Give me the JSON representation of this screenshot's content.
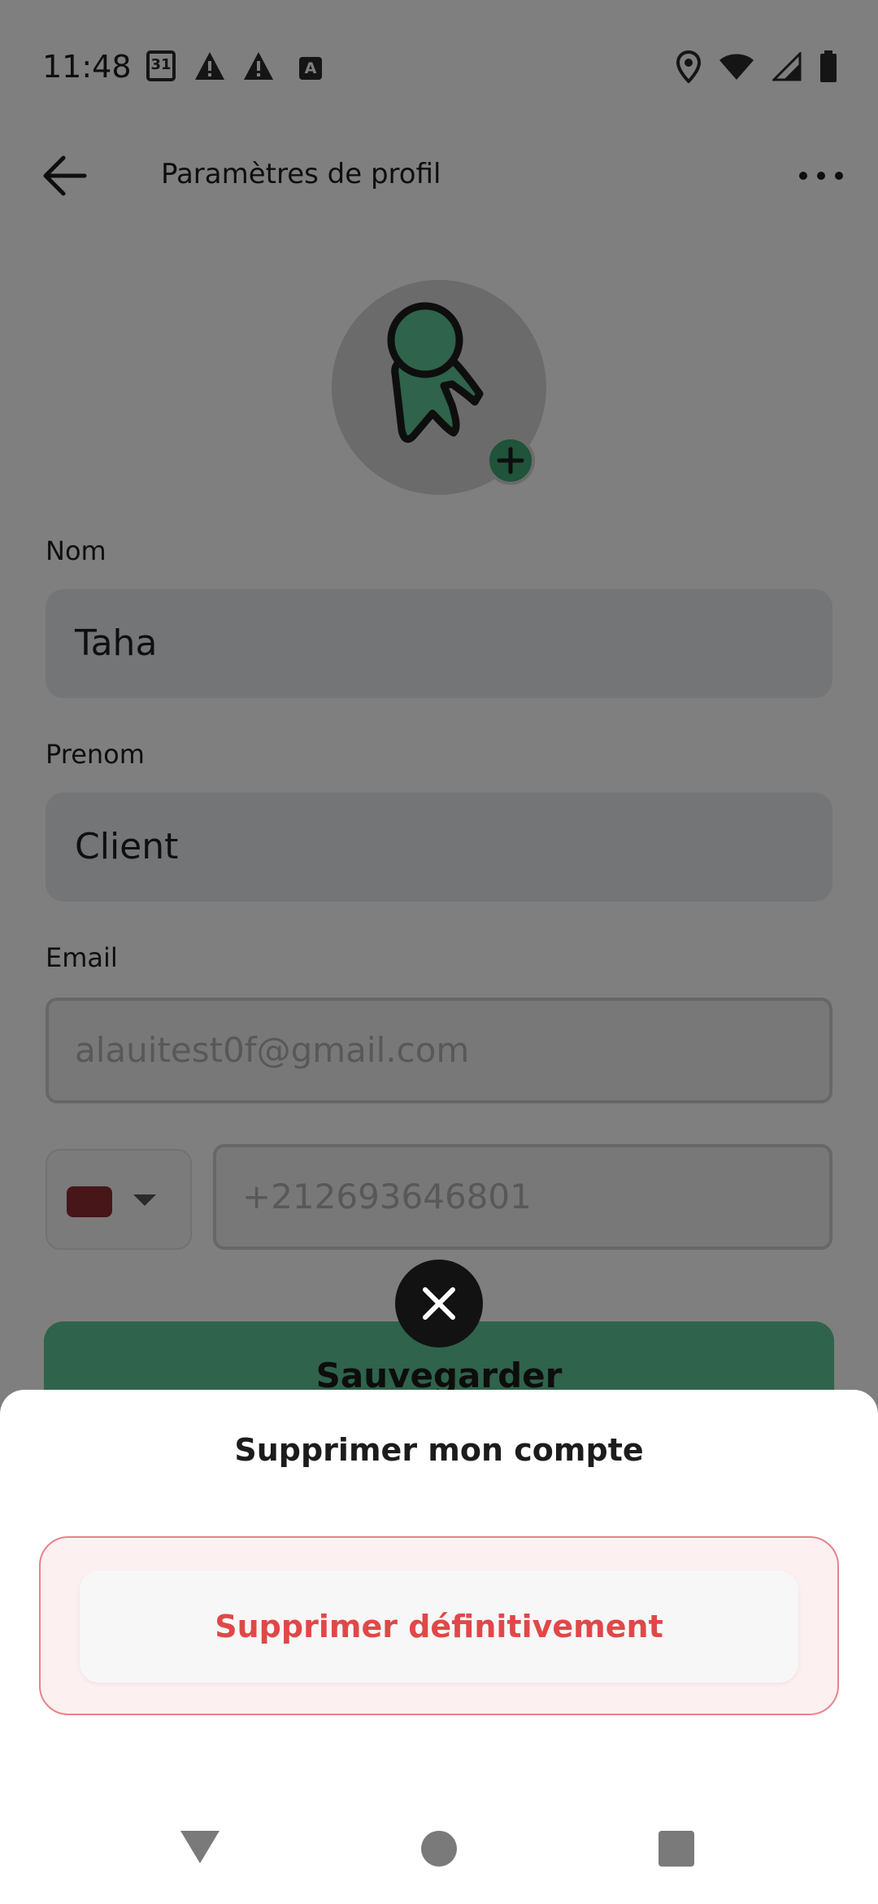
{
  "status_bar": {
    "time": "11:48",
    "calendar_day": "31",
    "icons": [
      "calendar-icon",
      "warning-icon",
      "warning-icon",
      "text-icon",
      "location-icon",
      "wifi-icon",
      "signal-icon",
      "battery-icon"
    ]
  },
  "header": {
    "title": "Paramètres de profil"
  },
  "form": {
    "nom_label": "Nom",
    "nom_value": "Taha",
    "prenom_label": "Prenom",
    "prenom_value": "Client",
    "email_label": "Email",
    "email_value": "alauitest0f@gmail.com",
    "phone_value": "+212693646801",
    "save_label": "Sauvegarder"
  },
  "modal": {
    "title": "Supprimer mon compte",
    "delete_label": "Supprimer définitivement"
  },
  "colors": {
    "accent_green": "#3ea675",
    "danger_red": "#e04848",
    "scrim": "rgba(0,0,0,0.5)"
  }
}
